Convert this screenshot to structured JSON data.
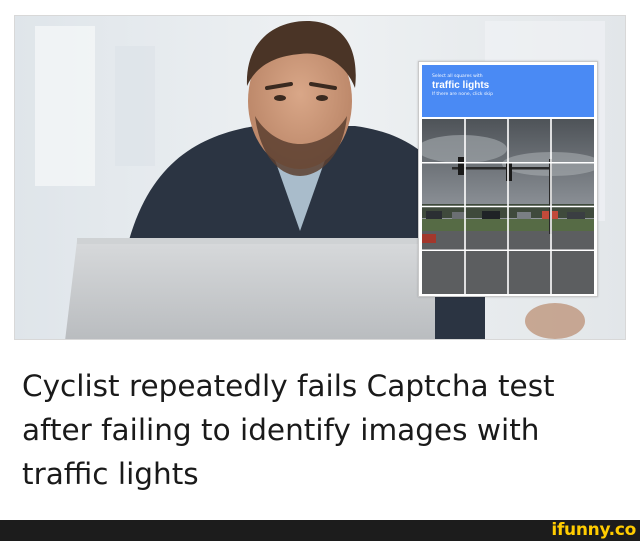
{
  "captcha": {
    "instruction_top": "Select all squares with",
    "target": "traffic lights",
    "instruction_bottom": "If there are none, click skip"
  },
  "headline": "Cyclist repeatedly fails Captcha test after failing to identify images with traffic lights",
  "footer": {
    "logo": "ifunny.co"
  },
  "colors": {
    "captcha_header": "#4a8af4",
    "footer_bg": "#1c1c1c",
    "logo": "#ffcc00"
  }
}
